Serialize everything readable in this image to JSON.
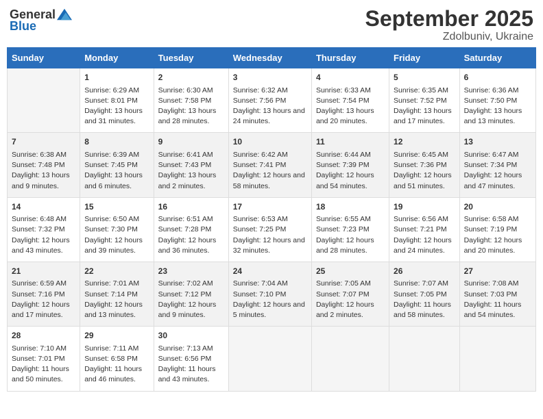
{
  "header": {
    "logo_general": "General",
    "logo_blue": "Blue",
    "title": "September 2025",
    "subtitle": "Zdolbuniv, Ukraine"
  },
  "days_of_week": [
    "Sunday",
    "Monday",
    "Tuesday",
    "Wednesday",
    "Thursday",
    "Friday",
    "Saturday"
  ],
  "weeks": [
    [
      {
        "day": "",
        "info": ""
      },
      {
        "day": "1",
        "info": "Sunrise: 6:29 AM\nSunset: 8:01 PM\nDaylight: 13 hours and 31 minutes."
      },
      {
        "day": "2",
        "info": "Sunrise: 6:30 AM\nSunset: 7:58 PM\nDaylight: 13 hours and 28 minutes."
      },
      {
        "day": "3",
        "info": "Sunrise: 6:32 AM\nSunset: 7:56 PM\nDaylight: 13 hours and 24 minutes."
      },
      {
        "day": "4",
        "info": "Sunrise: 6:33 AM\nSunset: 7:54 PM\nDaylight: 13 hours and 20 minutes."
      },
      {
        "day": "5",
        "info": "Sunrise: 6:35 AM\nSunset: 7:52 PM\nDaylight: 13 hours and 17 minutes."
      },
      {
        "day": "6",
        "info": "Sunrise: 6:36 AM\nSunset: 7:50 PM\nDaylight: 13 hours and 13 minutes."
      }
    ],
    [
      {
        "day": "7",
        "info": "Sunrise: 6:38 AM\nSunset: 7:48 PM\nDaylight: 13 hours and 9 minutes."
      },
      {
        "day": "8",
        "info": "Sunrise: 6:39 AM\nSunset: 7:45 PM\nDaylight: 13 hours and 6 minutes."
      },
      {
        "day": "9",
        "info": "Sunrise: 6:41 AM\nSunset: 7:43 PM\nDaylight: 13 hours and 2 minutes."
      },
      {
        "day": "10",
        "info": "Sunrise: 6:42 AM\nSunset: 7:41 PM\nDaylight: 12 hours and 58 minutes."
      },
      {
        "day": "11",
        "info": "Sunrise: 6:44 AM\nSunset: 7:39 PM\nDaylight: 12 hours and 54 minutes."
      },
      {
        "day": "12",
        "info": "Sunrise: 6:45 AM\nSunset: 7:36 PM\nDaylight: 12 hours and 51 minutes."
      },
      {
        "day": "13",
        "info": "Sunrise: 6:47 AM\nSunset: 7:34 PM\nDaylight: 12 hours and 47 minutes."
      }
    ],
    [
      {
        "day": "14",
        "info": "Sunrise: 6:48 AM\nSunset: 7:32 PM\nDaylight: 12 hours and 43 minutes."
      },
      {
        "day": "15",
        "info": "Sunrise: 6:50 AM\nSunset: 7:30 PM\nDaylight: 12 hours and 39 minutes."
      },
      {
        "day": "16",
        "info": "Sunrise: 6:51 AM\nSunset: 7:28 PM\nDaylight: 12 hours and 36 minutes."
      },
      {
        "day": "17",
        "info": "Sunrise: 6:53 AM\nSunset: 7:25 PM\nDaylight: 12 hours and 32 minutes."
      },
      {
        "day": "18",
        "info": "Sunrise: 6:55 AM\nSunset: 7:23 PM\nDaylight: 12 hours and 28 minutes."
      },
      {
        "day": "19",
        "info": "Sunrise: 6:56 AM\nSunset: 7:21 PM\nDaylight: 12 hours and 24 minutes."
      },
      {
        "day": "20",
        "info": "Sunrise: 6:58 AM\nSunset: 7:19 PM\nDaylight: 12 hours and 20 minutes."
      }
    ],
    [
      {
        "day": "21",
        "info": "Sunrise: 6:59 AM\nSunset: 7:16 PM\nDaylight: 12 hours and 17 minutes."
      },
      {
        "day": "22",
        "info": "Sunrise: 7:01 AM\nSunset: 7:14 PM\nDaylight: 12 hours and 13 minutes."
      },
      {
        "day": "23",
        "info": "Sunrise: 7:02 AM\nSunset: 7:12 PM\nDaylight: 12 hours and 9 minutes."
      },
      {
        "day": "24",
        "info": "Sunrise: 7:04 AM\nSunset: 7:10 PM\nDaylight: 12 hours and 5 minutes."
      },
      {
        "day": "25",
        "info": "Sunrise: 7:05 AM\nSunset: 7:07 PM\nDaylight: 12 hours and 2 minutes."
      },
      {
        "day": "26",
        "info": "Sunrise: 7:07 AM\nSunset: 7:05 PM\nDaylight: 11 hours and 58 minutes."
      },
      {
        "day": "27",
        "info": "Sunrise: 7:08 AM\nSunset: 7:03 PM\nDaylight: 11 hours and 54 minutes."
      }
    ],
    [
      {
        "day": "28",
        "info": "Sunrise: 7:10 AM\nSunset: 7:01 PM\nDaylight: 11 hours and 50 minutes."
      },
      {
        "day": "29",
        "info": "Sunrise: 7:11 AM\nSunset: 6:58 PM\nDaylight: 11 hours and 46 minutes."
      },
      {
        "day": "30",
        "info": "Sunrise: 7:13 AM\nSunset: 6:56 PM\nDaylight: 11 hours and 43 minutes."
      },
      {
        "day": "",
        "info": ""
      },
      {
        "day": "",
        "info": ""
      },
      {
        "day": "",
        "info": ""
      },
      {
        "day": "",
        "info": ""
      }
    ]
  ]
}
